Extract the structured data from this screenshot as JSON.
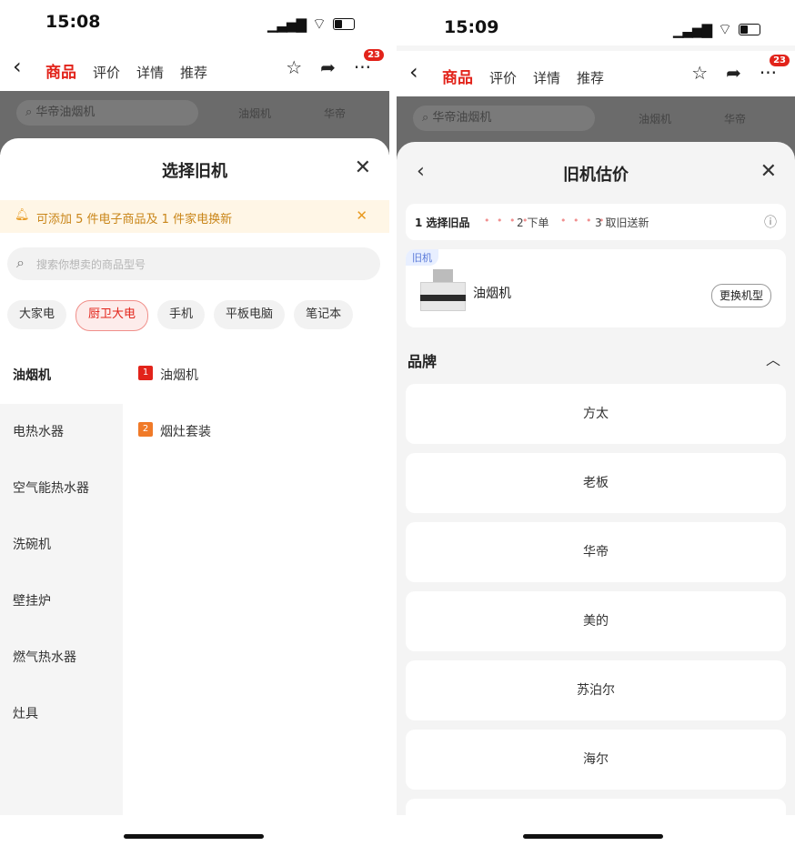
{
  "left": {
    "status": {
      "time": "15:08"
    },
    "nav": {
      "tabs": [
        "商品",
        "评价",
        "详情",
        "推荐"
      ],
      "badge": "23"
    },
    "dim": {
      "search": "华帝油烟机",
      "chip1": "油烟机",
      "chip2": "华帝"
    },
    "sheet": {
      "title": "选择旧机",
      "notice": "可添加 5 件电子商品及 1 件家电换新",
      "search_placeholder": "搜索你想卖的商品型号",
      "chips": [
        "大家电",
        "厨卫大电",
        "手机",
        "平板电脑",
        "笔记本"
      ],
      "active_chip": 1,
      "categories": [
        "油烟机",
        "电热水器",
        "空气能热水器",
        "洗碗机",
        "壁挂炉",
        "燃气热水器",
        "灶具"
      ],
      "active_category": 0,
      "subitems": [
        {
          "num": "1",
          "label": "油烟机"
        },
        {
          "num": "2",
          "label": "烟灶套装"
        }
      ]
    }
  },
  "right": {
    "status": {
      "time": "15:09"
    },
    "nav": {
      "tabs": [
        "商品",
        "评价",
        "详情",
        "推荐"
      ],
      "badge": "23"
    },
    "dim": {
      "search": "华帝油烟机",
      "chip1": "油烟机",
      "chip2": "华帝"
    },
    "sheet": {
      "title": "旧机估价",
      "steps": [
        "1 选择旧品",
        "2 下单",
        "3 取旧送新"
      ],
      "old": {
        "tag": "旧机",
        "name": "油烟机",
        "change_label": "更换机型"
      },
      "brand_title": "品牌",
      "brands": [
        "方太",
        "老板",
        "华帝",
        "美的",
        "苏泊尔",
        "海尔"
      ]
    }
  },
  "colors": {
    "accent": "#e2231a",
    "notice_bg": "#fff6e6",
    "notice_text": "#c98518"
  }
}
